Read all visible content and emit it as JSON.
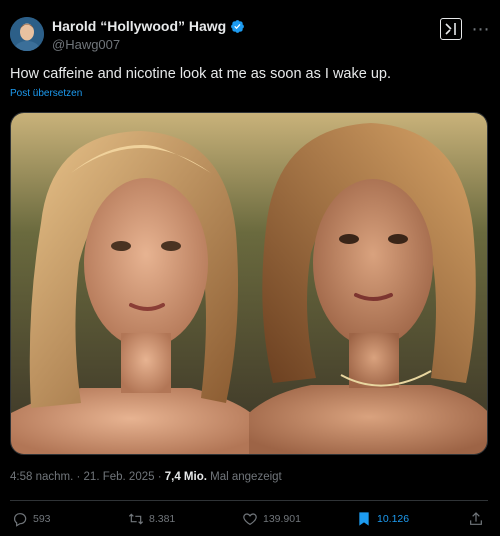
{
  "author": {
    "display_name": "Harold “Hollywood” Hawg",
    "handle": "@Hawg007"
  },
  "tweet": {
    "text": "How caffeine and nicotine look at me as soon as I wake up.",
    "translate_label": "Post übersetzen"
  },
  "meta": {
    "time": "4:58 nachm.",
    "date": "21. Feb. 2025",
    "views_count": "7,4 Mio.",
    "views_label": "Mal angezeigt"
  },
  "actions": {
    "replies": "593",
    "reposts": "8.381",
    "likes": "139.901",
    "bookmarks": "10.126"
  },
  "colors": {
    "background": "#000000",
    "accent": "#1d9bf0",
    "muted": "#71767b",
    "text": "#e7e9ea"
  },
  "icons": [
    "verified-badge-icon",
    "grok-icon",
    "more-icon",
    "reply-icon",
    "repost-icon",
    "like-icon",
    "bookmark-icon",
    "share-icon"
  ]
}
